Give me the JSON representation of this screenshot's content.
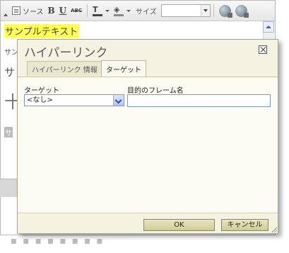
{
  "toolbar": {
    "source_label": "ソース",
    "bold_label": "B",
    "underline_label": "U",
    "strike_label": "ABC",
    "text_color_glyph": "T",
    "size_label": "サイズ",
    "size_value": ""
  },
  "editor": {
    "highlighted_text": "サンプルテキスト",
    "fragment_1": "サン",
    "fragment_2": "サ",
    "fragment_3": "十",
    "fragment_4": "サ"
  },
  "dialog": {
    "title": "ハイパーリンク",
    "tabs": [
      {
        "label": "ハイパーリンク 情報",
        "active": false
      },
      {
        "label": "ターゲット",
        "active": true
      }
    ],
    "target_label": "ターゲット",
    "target_selected": "<なし>",
    "frame_name_label": "目的のフレーム名",
    "frame_name_value": "",
    "ok_label": "OK",
    "cancel_label": "キャンセル"
  },
  "colors": {
    "highlight": "#ffff55",
    "dialog_bg": "#f4f3e1",
    "button_bg": "#cfcb98"
  }
}
